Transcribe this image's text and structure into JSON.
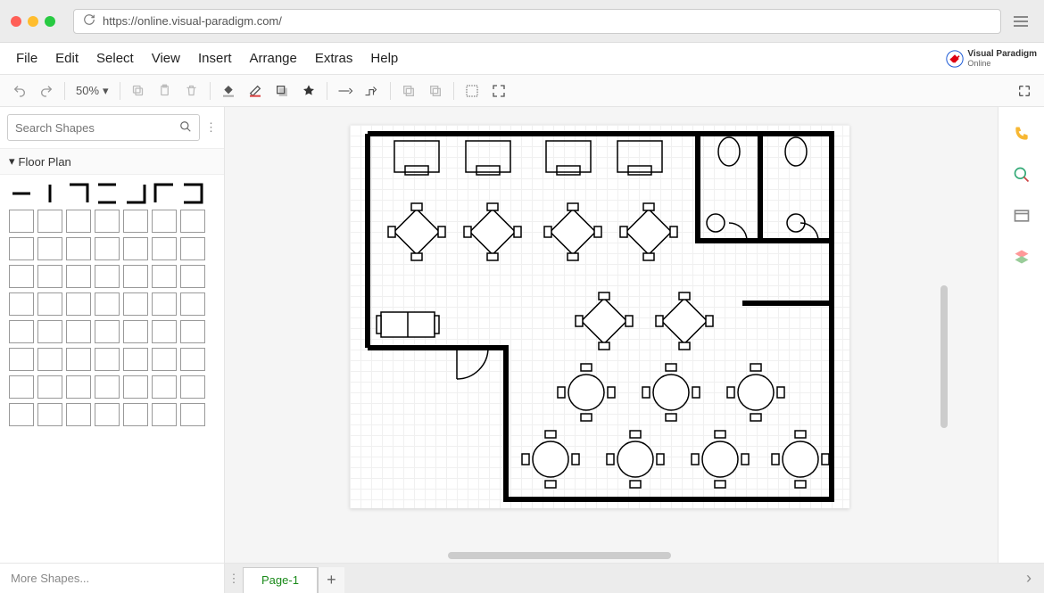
{
  "browser": {
    "url": "https://online.visual-paradigm.com/"
  },
  "brand": {
    "line1": "Visual Paradigm",
    "line2": "Online"
  },
  "menu": {
    "items": [
      "File",
      "Edit",
      "Select",
      "View",
      "Insert",
      "Arrange",
      "Extras",
      "Help"
    ]
  },
  "toolbar": {
    "zoom": "50%"
  },
  "sidebar": {
    "search_placeholder": "Search Shapes",
    "palette_title": "Floor Plan",
    "more_shapes": "More Shapes..."
  },
  "tabs": {
    "page1": "Page-1"
  },
  "canvas": {
    "description": "Restaurant floor plan with booths, diamond tables, round tables, a sofa, two restrooms with toilets and sinks."
  }
}
